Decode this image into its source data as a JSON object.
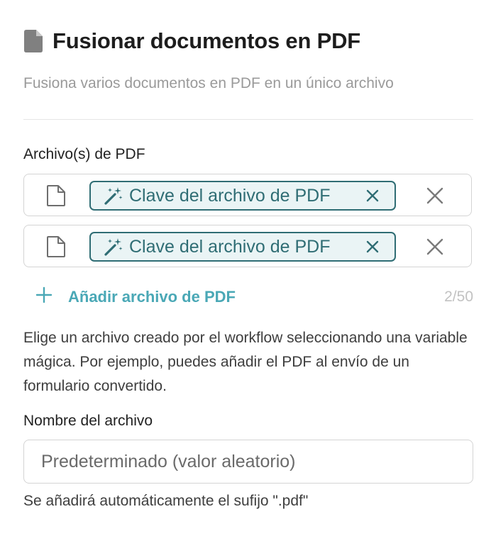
{
  "header": {
    "title": "Fusionar documentos en PDF",
    "subtitle": "Fusiona varios documentos en PDF en un único archivo"
  },
  "pdf_files": {
    "label": "Archivo(s) de PDF",
    "items": [
      {
        "chip_label": "Clave del archivo de PDF"
      },
      {
        "chip_label": "Clave del archivo de PDF"
      }
    ],
    "add_label": "Añadir archivo de PDF",
    "counter": "2/50",
    "help": "Elige un archivo creado por el workflow seleccionando una variable mágica. Por ejemplo, puedes añadir el PDF al envío de un formulario convertido."
  },
  "filename": {
    "label": "Nombre del archivo",
    "placeholder": "Predeterminado (valor aleatorio)",
    "hint": "Se añadirá automáticamente el sufijo \".pdf\""
  },
  "colors": {
    "accent": "#4aa8b6",
    "chip_border": "#2f6d74",
    "chip_background": "#eaf4f5",
    "muted_text": "#9a9a9a"
  },
  "icons": {
    "title": "document-icon",
    "file_row": "file-outline-icon",
    "chip": "magic-wand-icon",
    "chip_remove": "close-icon",
    "row_remove": "close-icon",
    "add": "plus-icon"
  }
}
